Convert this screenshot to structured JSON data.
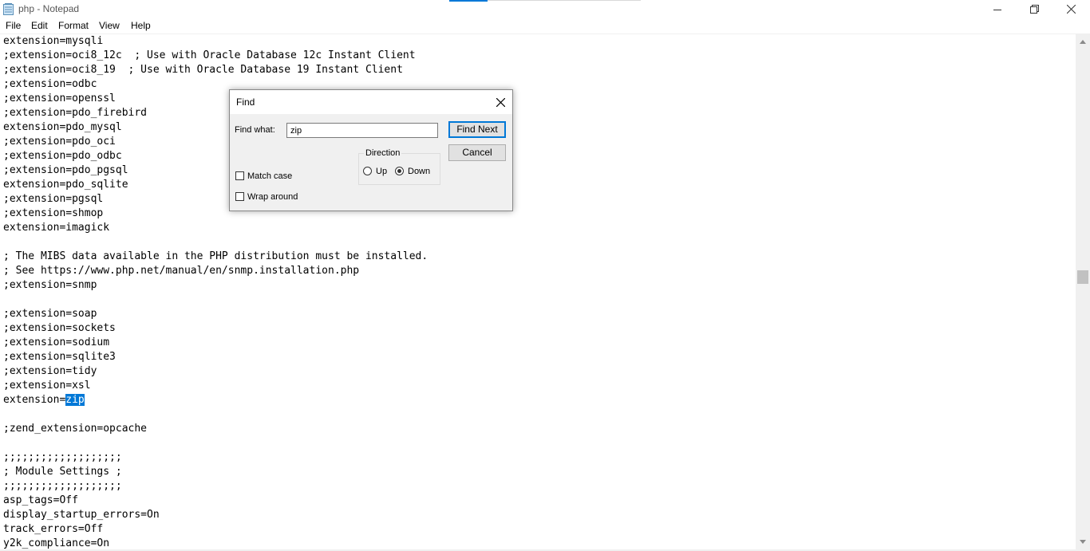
{
  "window": {
    "title": "php - Notepad",
    "menu": [
      "File",
      "Edit",
      "Format",
      "View",
      "Help"
    ]
  },
  "editor": {
    "lines": [
      "extension=mysqli",
      ";extension=oci8_12c  ; Use with Oracle Database 12c Instant Client",
      ";extension=oci8_19  ; Use with Oracle Database 19 Instant Client",
      ";extension=odbc",
      ";extension=openssl",
      ";extension=pdo_firebird",
      "extension=pdo_mysql",
      ";extension=pdo_oci",
      ";extension=pdo_odbc",
      ";extension=pdo_pgsql",
      "extension=pdo_sqlite",
      ";extension=pgsql",
      ";extension=shmop",
      "extension=imagick",
      "",
      "; The MIBS data available in the PHP distribution must be installed.",
      "; See https://www.php.net/manual/en/snmp.installation.php",
      ";extension=snmp",
      "",
      ";extension=soap",
      ";extension=sockets",
      ";extension=sodium",
      ";extension=sqlite3",
      ";extension=tidy",
      ";extension=xsl",
      "",
      "",
      ";zend_extension=opcache",
      "",
      ";;;;;;;;;;;;;;;;;;;",
      "; Module Settings ;",
      ";;;;;;;;;;;;;;;;;;;",
      "asp_tags=Off",
      "display_startup_errors=On",
      "track_errors=Off",
      "y2k_compliance=On"
    ],
    "selected_line": {
      "prefix": "extension=",
      "selected": "zip"
    }
  },
  "find_dialog": {
    "title": "Find",
    "find_what_label": "Find what:",
    "find_what_value": "zip",
    "find_next_label": "Find Next",
    "cancel_label": "Cancel",
    "direction_label": "Direction",
    "up_label": "Up",
    "down_label": "Down",
    "direction_selected": "Down",
    "match_case_label": "Match case",
    "match_case_checked": false,
    "wrap_around_label": "Wrap around",
    "wrap_around_checked": false
  },
  "colors": {
    "selection": "#0078d7",
    "accent": "#0078d7"
  }
}
